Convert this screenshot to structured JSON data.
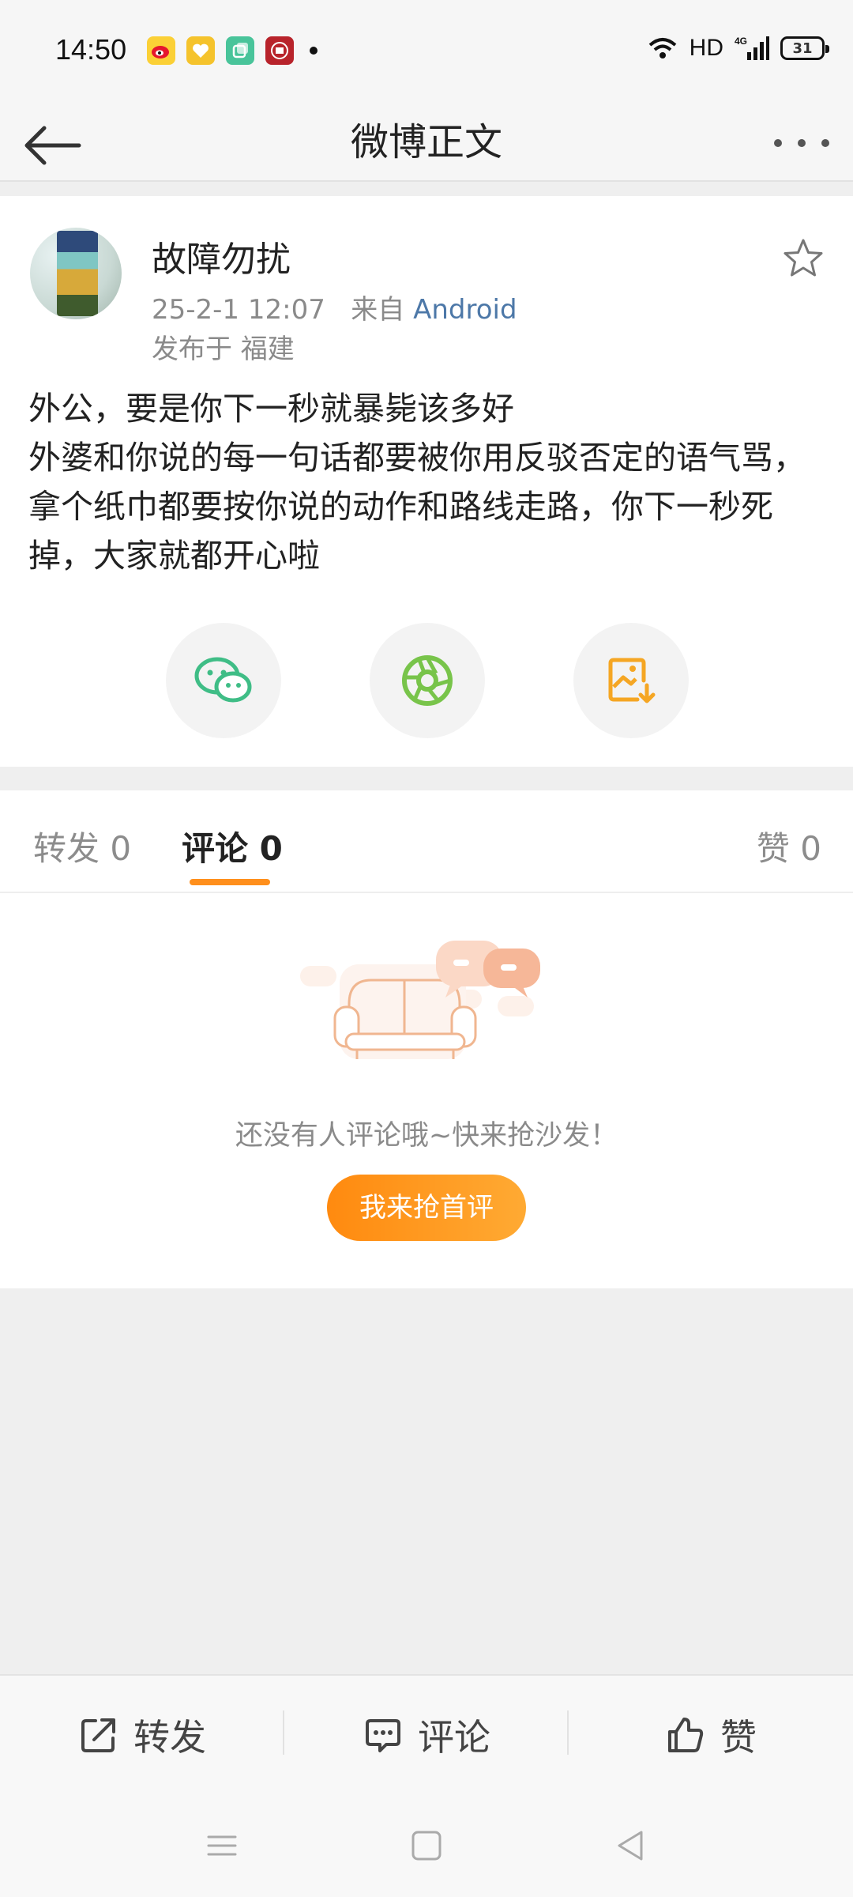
{
  "status_bar": {
    "time": "14:50",
    "network": "HD",
    "signal_label": "4G",
    "battery": "31",
    "app_icons": [
      "weibo-icon",
      "heart-app-icon",
      "layers-app-icon",
      "red-app-icon"
    ]
  },
  "header": {
    "title": "微博正文",
    "back_icon": "back-arrow-icon",
    "more_icon": "more-dots-icon"
  },
  "post": {
    "username": "故障勿扰",
    "timestamp": "25-2-1 12:07",
    "source_prefix": "来自",
    "source": "Android",
    "location": "发布于 福建",
    "text_lines": [
      "外公，要是你下一秒就暴毙该多好",
      "外婆和你说的每一句话都要被你用反驳否定的语气骂，拿个纸巾都要按你说的动作和路线走路，你下一秒死掉，大家就都开心啦"
    ],
    "share_targets": [
      "wechat-icon",
      "moments-icon",
      "save-image-icon"
    ]
  },
  "tabs": {
    "repost": "转发 0",
    "comment": "评论 0",
    "like": "赞 0",
    "active": "comment"
  },
  "empty_state": {
    "message": "还没有人评论哦~快来抢沙发！",
    "button": "我来抢首评"
  },
  "actions": {
    "repost": "转发",
    "comment": "评论",
    "like": "赞"
  },
  "colors": {
    "accent": "#ff8f1c",
    "source_link": "#4d78a8",
    "wechat": "#3fbd86",
    "moments": "#78c44a",
    "save": "#f5a623"
  }
}
